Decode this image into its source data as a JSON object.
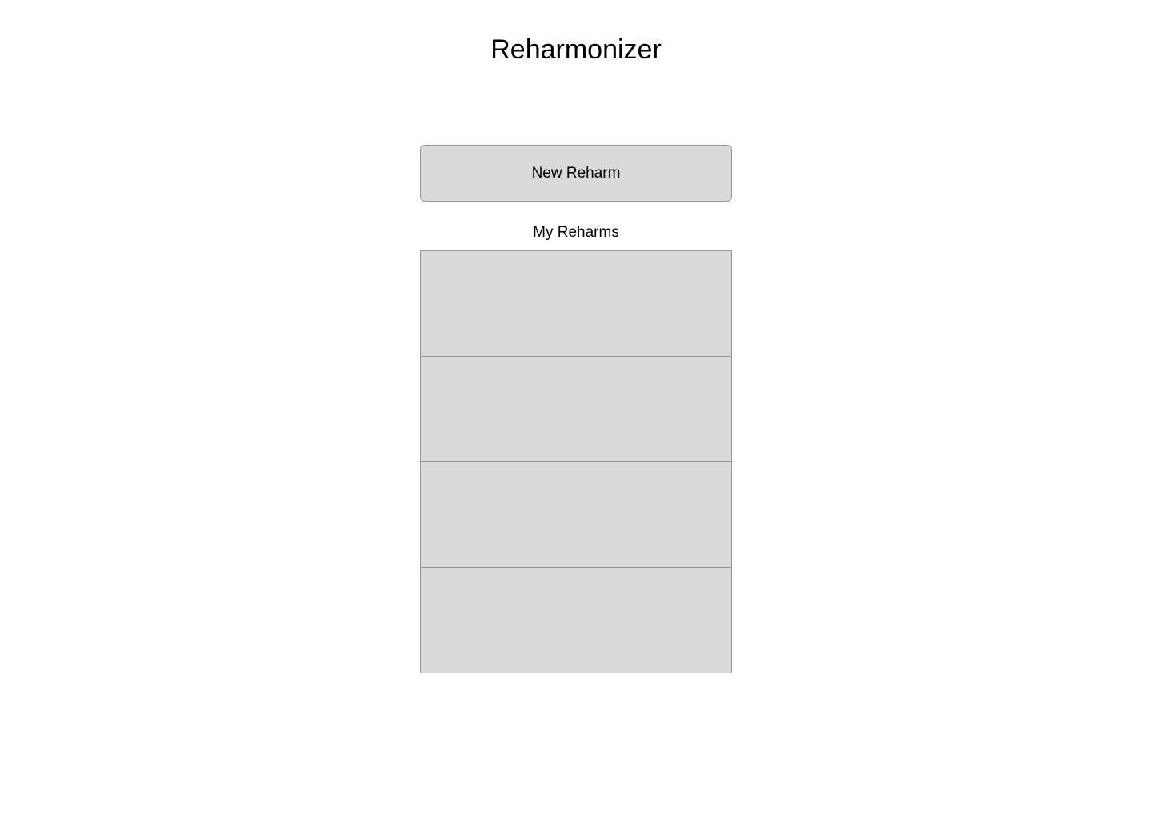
{
  "header": {
    "title": "Reharmonizer"
  },
  "actions": {
    "new_reharm_label": "New Reharm"
  },
  "reharms": {
    "section_label": "My Reharms",
    "items": [
      {
        "label": ""
      },
      {
        "label": ""
      },
      {
        "label": ""
      },
      {
        "label": ""
      }
    ]
  },
  "colors": {
    "card_fill": "#d9d9d9",
    "card_border": "#979797",
    "background": "#ffffff",
    "text": "#000000"
  }
}
